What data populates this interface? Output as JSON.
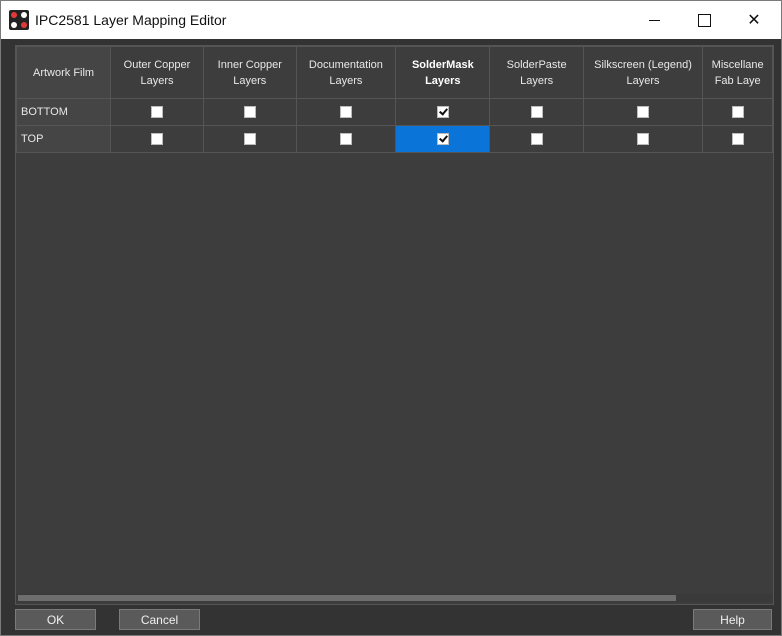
{
  "window": {
    "title": "IPC2581 Layer Mapping Editor",
    "icon": "app-logo-icon",
    "minimize_icon": "minimize-icon",
    "maximize_icon": "maximize-icon",
    "close_icon": "close-icon",
    "close_glyph": "✕"
  },
  "grid": {
    "corner_label": "Artwork Film",
    "columns": [
      {
        "line1": "Outer Copper",
        "line2": "Layers",
        "bold": false
      },
      {
        "line1": "Inner Copper",
        "line2": "Layers",
        "bold": false
      },
      {
        "line1": "Documentation",
        "line2": "Layers",
        "bold": false
      },
      {
        "line1": "SolderMask",
        "line2": "Layers",
        "bold": true
      },
      {
        "line1": "SolderPaste",
        "line2": "Layers",
        "bold": false
      },
      {
        "line1": "Silkscreen (Legend)",
        "line2": "Layers",
        "bold": false
      },
      {
        "line1": "Miscellane",
        "line2": "Fab Laye",
        "bold": false
      }
    ],
    "rows": [
      {
        "label": "BOTTOM",
        "checked": [
          false,
          false,
          false,
          true,
          false,
          false,
          false
        ]
      },
      {
        "label": "TOP",
        "checked": [
          false,
          false,
          false,
          true,
          false,
          false,
          false
        ]
      }
    ],
    "selected_cell": {
      "row": 1,
      "col": 3
    },
    "colors": {
      "selection": "#0a74d9",
      "background": "#3d3d3d",
      "frame": "#333333"
    }
  },
  "buttons": {
    "ok": "OK",
    "cancel": "Cancel",
    "help": "Help"
  }
}
